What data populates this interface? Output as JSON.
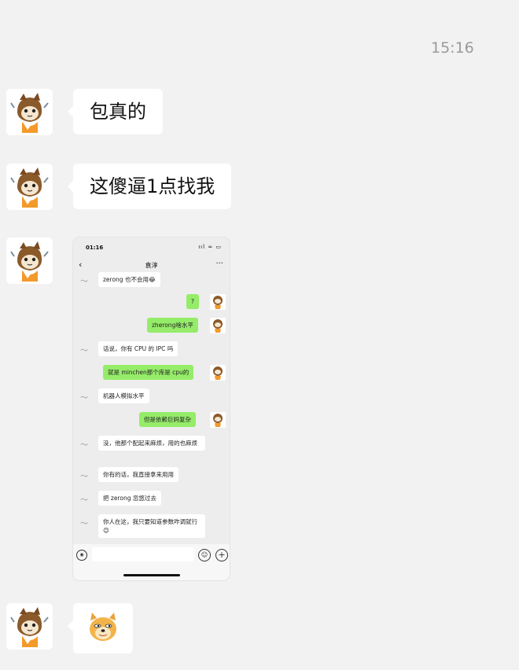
{
  "timestamp": "15:16",
  "messages": [
    {
      "text": "包真的"
    },
    {
      "text": "这傻逼1点找我"
    }
  ],
  "screenshot": {
    "status_time": "01:16",
    "status_icons": "ııl ≈ ▭",
    "back_icon": "‹",
    "contact_name": "袁淳",
    "more_icon": "···",
    "chat": [
      {
        "side": "left",
        "text": "zerong 也不会用😂"
      },
      {
        "side": "right",
        "text": "?"
      },
      {
        "side": "right",
        "text": "zherong啥水平"
      },
      {
        "side": "left",
        "text": "话说，你有 CPU 的 IPC 吗"
      },
      {
        "side": "right",
        "text": "就是 minchen那个库是 cpu的"
      },
      {
        "side": "left",
        "text": "机器人模拟水平"
      },
      {
        "side": "right",
        "text": "但是依赖巨妈复杂"
      },
      {
        "side": "left",
        "text": "没，他那个配起来麻烦，用的也麻烦"
      },
      {
        "side": "left",
        "text": "你有的话，我直接拿来用用"
      },
      {
        "side": "left",
        "text": "把 zerong 忽悠过去"
      },
      {
        "side": "left",
        "text": "你人在这，我只要知道参数咋调就行😊"
      }
    ]
  },
  "colors": {
    "background": "#f2f2f2",
    "bubble": "#ffffff",
    "sent_bubble": "#95ec69",
    "timestamp": "#9a9a9a"
  }
}
